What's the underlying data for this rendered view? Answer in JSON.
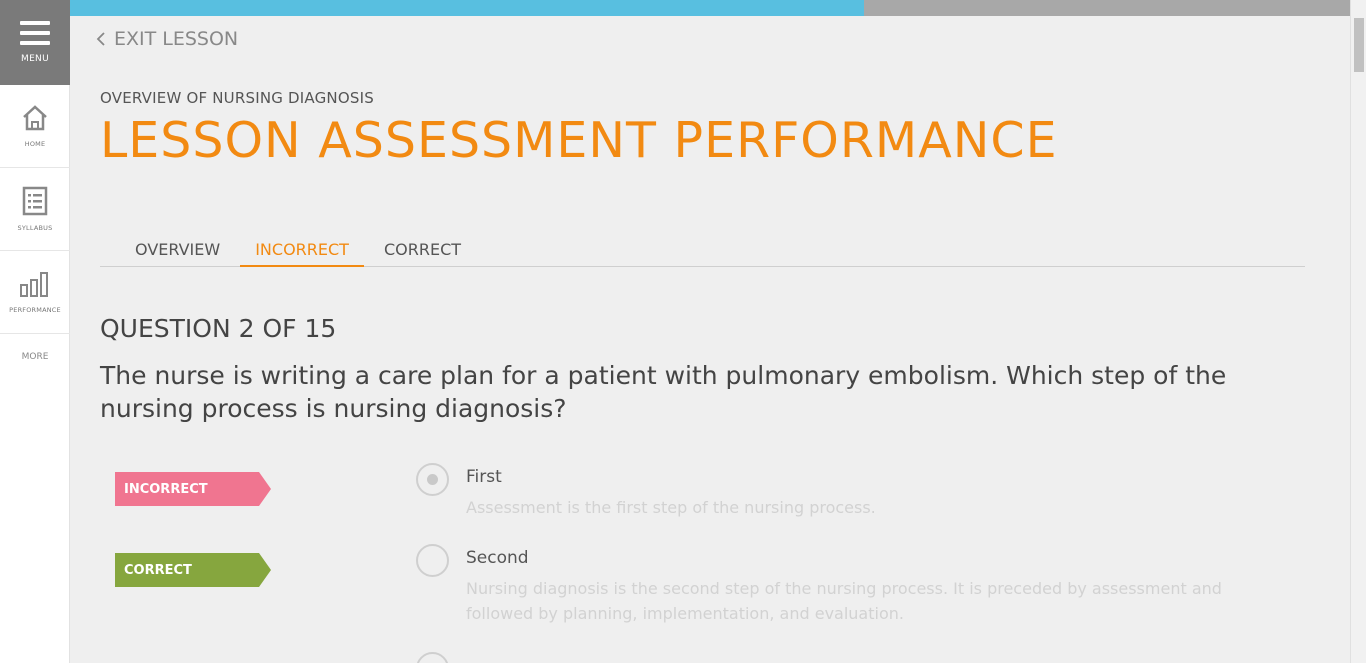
{
  "sidebar": {
    "menu_label": "MENU",
    "items": [
      {
        "label": "HOME",
        "icon": "home-icon"
      },
      {
        "label": "SYLLABUS",
        "icon": "syllabus-icon"
      },
      {
        "label": "PERFORMANCE",
        "icon": "bar-chart-icon"
      }
    ],
    "more_label": "MORE"
  },
  "progress": {
    "fraction": 0.62,
    "fill_color": "#58bfe0",
    "track_color": "#a8a8a8"
  },
  "header": {
    "exit_label": "EXIT LESSON",
    "subtitle": "OVERVIEW OF NURSING DIAGNOSIS",
    "title": "LESSON ASSESSMENT PERFORMANCE"
  },
  "tabs": [
    {
      "label": "OVERVIEW",
      "active": false
    },
    {
      "label": "INCORRECT",
      "active": true
    },
    {
      "label": "CORRECT",
      "active": false
    }
  ],
  "question": {
    "number_label": "QUESTION 2 OF 15",
    "text": "The nurse is writing a care plan for a patient with pulmonary embolism. Which step of the nursing process is nursing diagnosis?"
  },
  "flags": {
    "incorrect": "INCORRECT",
    "correct": "CORRECT"
  },
  "options": [
    {
      "label": "First",
      "rationale": "Assessment is the first step of the nursing process.",
      "selected": true
    },
    {
      "label": "Second",
      "rationale": "Nursing diagnosis is the second step of the nursing process. It is preceded by assessment and followed by planning, implementation, and evaluation.",
      "selected": false
    }
  ],
  "colors": {
    "accent": "#f28a12",
    "incorrect": "#f07590",
    "correct": "#86a63e"
  }
}
